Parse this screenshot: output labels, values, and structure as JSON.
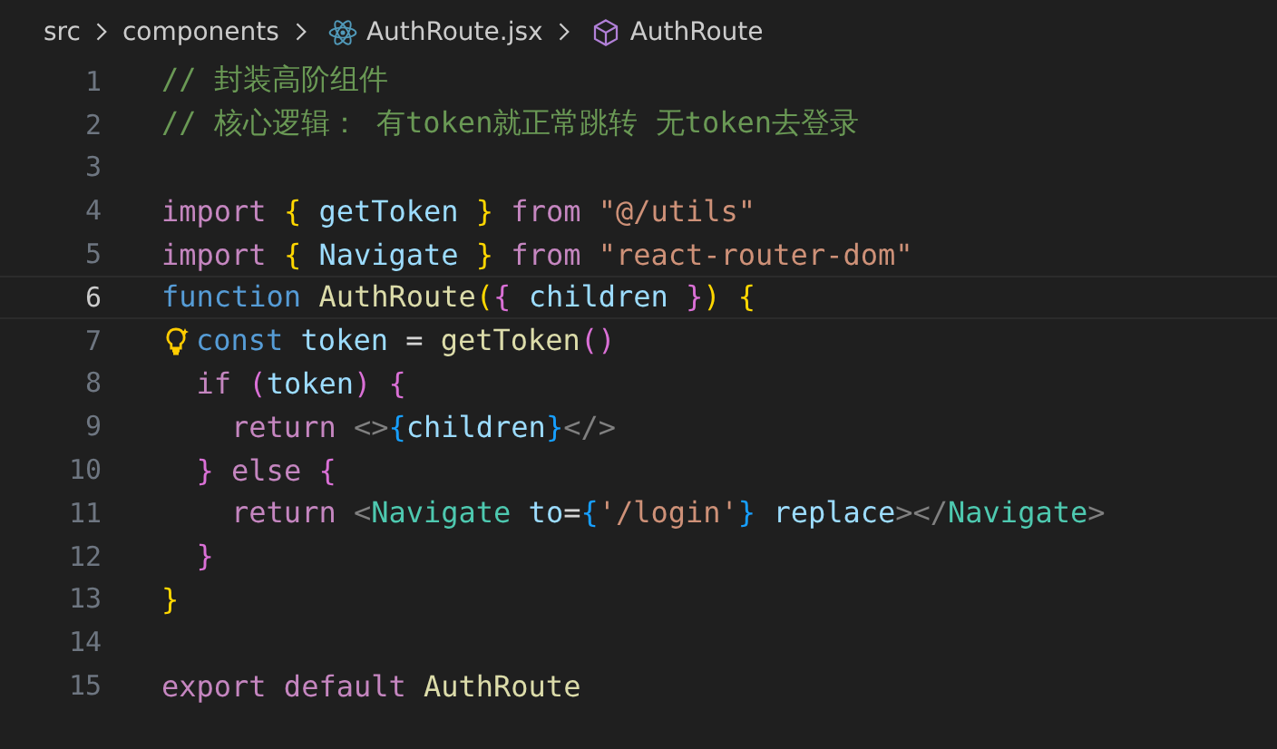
{
  "breadcrumb": [
    {
      "label": "src",
      "kind": "folder"
    },
    {
      "label": "components",
      "kind": "folder"
    },
    {
      "label": "AuthRoute.jsx",
      "kind": "file"
    },
    {
      "label": "AuthRoute",
      "kind": "symbol"
    }
  ],
  "lines": [
    {
      "number": "1",
      "current": false,
      "tokens": [
        {
          "kind": "comment",
          "text": "// 封装高阶组件"
        }
      ]
    },
    {
      "number": "2",
      "current": false,
      "tokens": [
        {
          "kind": "comment",
          "text": "// 核心逻辑： 有token就正常跳转 无token去登录"
        }
      ]
    },
    {
      "number": "3",
      "current": false
    },
    {
      "number": "4",
      "current": false,
      "tokens": [
        {
          "kind": "control",
          "text": "import "
        },
        {
          "kind": "bracket1",
          "text": "{"
        },
        {
          "kind": "variable",
          "text": " getToken "
        },
        {
          "kind": "bracket1",
          "text": "}"
        },
        {
          "kind": "control",
          "text": " from "
        },
        {
          "kind": "string",
          "text": "\"@/utils\""
        }
      ]
    },
    {
      "number": "5",
      "current": false,
      "tokens": [
        {
          "kind": "control",
          "text": "import "
        },
        {
          "kind": "bracket1",
          "text": "{"
        },
        {
          "kind": "variable",
          "text": " Navigate "
        },
        {
          "kind": "bracket1",
          "text": "}"
        },
        {
          "kind": "control",
          "text": " from "
        },
        {
          "kind": "string",
          "text": "\"react-router-dom\""
        }
      ]
    },
    {
      "number": "6",
      "current": true,
      "tokens": [
        {
          "kind": "keyword",
          "text": "function "
        },
        {
          "kind": "function",
          "text": "AuthRoute"
        },
        {
          "kind": "bracket1",
          "text": "("
        },
        {
          "kind": "bracket2",
          "text": "{"
        },
        {
          "kind": "variable",
          "text": " children "
        },
        {
          "kind": "bracket2",
          "text": "}"
        },
        {
          "kind": "bracket1",
          "text": ") {"
        }
      ]
    },
    {
      "number": "7",
      "current": false,
      "lightbulb": true,
      "tokens": [
        {
          "kind": "keyword",
          "text": "const "
        },
        {
          "kind": "variable",
          "text": "token"
        },
        {
          "kind": "plain",
          "text": " = "
        },
        {
          "kind": "function",
          "text": "getToken"
        },
        {
          "kind": "bracket2",
          "text": "()"
        }
      ]
    },
    {
      "number": "8",
      "current": false,
      "tokens": [
        {
          "kind": "control",
          "text": "  if "
        },
        {
          "kind": "bracket2",
          "text": "("
        },
        {
          "kind": "variable",
          "text": "token"
        },
        {
          "kind": "bracket2",
          "text": ") {"
        }
      ]
    },
    {
      "number": "9",
      "current": false,
      "tokens": [
        {
          "kind": "control",
          "text": "    return "
        },
        {
          "kind": "jsx",
          "text": "<>"
        },
        {
          "kind": "bracket3",
          "text": "{"
        },
        {
          "kind": "variable",
          "text": "children"
        },
        {
          "kind": "bracket3",
          "text": "}"
        },
        {
          "kind": "jsx",
          "text": "</>"
        }
      ]
    },
    {
      "number": "10",
      "current": false,
      "tokens": [
        {
          "kind": "bracket2",
          "text": "  }"
        },
        {
          "kind": "control",
          "text": " else "
        },
        {
          "kind": "bracket2",
          "text": "{"
        }
      ]
    },
    {
      "number": "11",
      "current": false,
      "tokens": [
        {
          "kind": "control",
          "text": "    return "
        },
        {
          "kind": "jsx",
          "text": "<"
        },
        {
          "kind": "tag",
          "text": "Navigate"
        },
        {
          "kind": "variable",
          "text": " to"
        },
        {
          "kind": "plain",
          "text": "="
        },
        {
          "kind": "bracket3",
          "text": "{"
        },
        {
          "kind": "string",
          "text": "'/login'"
        },
        {
          "kind": "bracket3",
          "text": "}"
        },
        {
          "kind": "variable",
          "text": " replace"
        },
        {
          "kind": "jsx",
          "text": "></"
        },
        {
          "kind": "tag",
          "text": "Navigate"
        },
        {
          "kind": "jsx",
          "text": ">"
        }
      ]
    },
    {
      "number": "12",
      "current": false,
      "tokens": [
        {
          "kind": "bracket2",
          "text": "  }"
        }
      ]
    },
    {
      "number": "13",
      "current": false,
      "tokens": [
        {
          "kind": "bracket1",
          "text": "}"
        }
      ]
    },
    {
      "number": "14",
      "current": false
    },
    {
      "number": "15",
      "current": false,
      "tokens": [
        {
          "kind": "control",
          "text": "export default "
        },
        {
          "kind": "function",
          "text": "AuthRoute"
        }
      ]
    }
  ]
}
